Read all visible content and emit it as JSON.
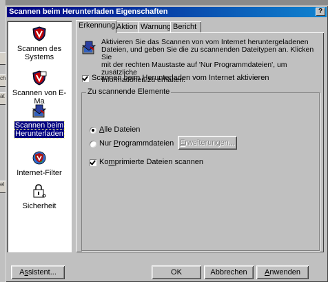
{
  "window": {
    "title": "Scannen beim Herunterladen Eigenschaften",
    "help": "?"
  },
  "background": {
    "fragments": [
      "ch",
      "at",
      "el"
    ]
  },
  "sidebar": {
    "items": [
      {
        "label1": "Scannen des",
        "label2": "Systems",
        "icon": "shield-v-icon"
      },
      {
        "label1": "Scannen von E-Ma",
        "label2": "",
        "icon": "shield-mail-icon"
      },
      {
        "label1": "Scannen beim",
        "label2": "Herunterladen",
        "icon": "download-scan-icon",
        "selected": true
      },
      {
        "label1": "Internet-Filter",
        "label2": "",
        "icon": "globe-shield-icon"
      },
      {
        "label1": "Sicherheit",
        "label2": "",
        "icon": "lock-icon"
      }
    ]
  },
  "tabs": [
    "Erkennung",
    "Aktion",
    "Warnung",
    "Bericht"
  ],
  "intro": {
    "line1": "Aktivieren Sie das Scannen von vom Internet heruntergeladenen",
    "line2": "Dateien, und geben Sie die zu scannenden Dateitypen an. Klicken Sie",
    "line3": "mit der rechten Maustaste auf 'Nur Programmdateien', um zusätzliche",
    "line4": "Informationen zu erhalten."
  },
  "enable_checkbox": {
    "pre": "Scannen beim ",
    "ul": "H",
    "post": "erunterladen vom Internet aktivieren",
    "checked": true
  },
  "group": {
    "title": "Zu scannende Elemente",
    "all_files": {
      "ul": "A",
      "post": "lle Dateien",
      "selected": true
    },
    "program_files": {
      "pre": "Nur ",
      "ul": "P",
      "post": "rogrammdateien",
      "selected": false
    },
    "extensions_button": {
      "ul": "E",
      "post": "rweiterungen..."
    },
    "compressed": {
      "pre": "Ko",
      "ul": "m",
      "post": "primierte Dateien scannen",
      "checked": true
    }
  },
  "buttons": {
    "wizard": {
      "pre": "A",
      "ul": "s",
      "post": "sistent..."
    },
    "ok": "OK",
    "cancel": "Abbrechen",
    "apply": {
      "ul": "A",
      "post": "nwenden"
    }
  }
}
